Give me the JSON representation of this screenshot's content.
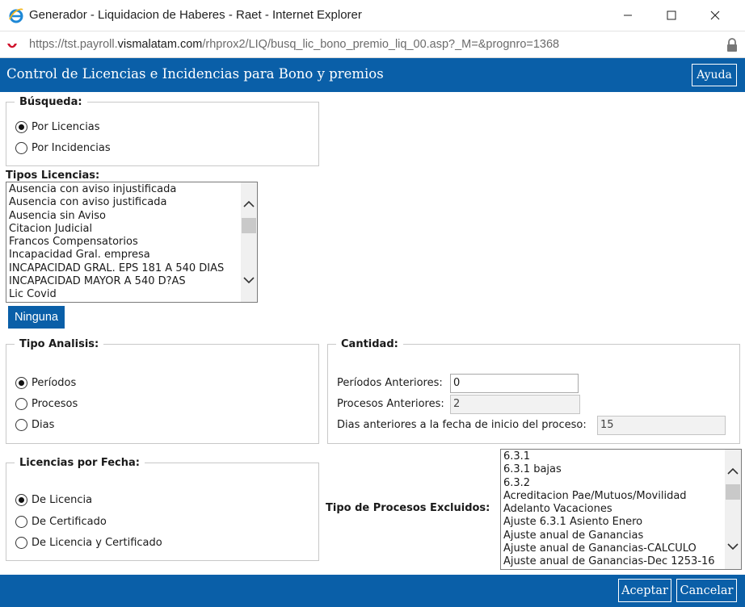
{
  "window": {
    "title": "Generador - Liquidacion de Haberes - Raet - Internet Explorer",
    "min_glyph": "—",
    "max_glyph": "☐",
    "close_glyph": "✕"
  },
  "address": {
    "url_prefix": "https://tst.payroll.",
    "url_host": "vismalatam.com",
    "url_path": "/rhprox2/LIQ/busq_lic_bono_premio_liq_00.asp?_M=&prognro=1368"
  },
  "header": {
    "title": "Control de Licencias e Incidencias para Bono y premios",
    "help_label": "Ayuda"
  },
  "busqueda": {
    "legend": "Búsqueda:",
    "options": [
      {
        "label": "Por Licencias",
        "selected": true
      },
      {
        "label": "Por Incidencias",
        "selected": false
      }
    ]
  },
  "tipos_licencias": {
    "label": "Tipos Licencias:",
    "items": [
      "Ausencia con aviso injustificada",
      "Ausencia con aviso justificada",
      "Ausencia sin Aviso",
      "Citacion Judicial",
      "Francos Compensatorios",
      "Incapacidad Gral. empresa",
      "INCAPACIDAD GRAL. EPS 181 A 540 DIAS",
      "INCAPACIDAD MAYOR A 540 D?AS",
      "Lic Covid"
    ],
    "none_label": "Ninguna"
  },
  "tipo_analisis": {
    "legend": "Tipo Analisis:",
    "options": [
      {
        "label": "Períodos",
        "selected": true
      },
      {
        "label": "Procesos",
        "selected": false
      },
      {
        "label": "Dias",
        "selected": false
      }
    ]
  },
  "cantidad": {
    "legend": "Cantidad:",
    "periodos_label": "Períodos Anteriores:",
    "periodos_value": "0",
    "procesos_label": "Procesos Anteriores:",
    "procesos_value": "2",
    "dias_label": "Dias anteriores a la fecha de inicio del proceso:",
    "dias_value": "15"
  },
  "licencias_fecha": {
    "legend": "Licencias por Fecha:",
    "options": [
      {
        "label": "De Licencia",
        "selected": true
      },
      {
        "label": "De Certificado",
        "selected": false
      },
      {
        "label": "De Licencia y Certificado",
        "selected": false
      }
    ]
  },
  "procesos_excluidos": {
    "label": "Tipo de Procesos Excluidos:",
    "items": [
      "6.3.1",
      "6.3.1 bajas",
      "6.3.2",
      "Acreditacion Pae/Mutuos/Movilidad",
      "Adelanto Vacaciones",
      "Ajuste 6.3.1 Asiento Enero",
      "Ajuste anual de Ganancias",
      "Ajuste anual de Ganancias-CALCULO",
      "Ajuste anual de Ganancias-Dec 1253-16"
    ]
  },
  "footer": {
    "accept_label": "Aceptar",
    "cancel_label": "Cancelar"
  },
  "colors": {
    "brand_blue": "#0a5fa8",
    "border_gray": "#c8c8c8"
  },
  "icons": {
    "browser": "internet-explorer-icon",
    "site": "visma-site-icon",
    "lock": "lock-icon"
  }
}
